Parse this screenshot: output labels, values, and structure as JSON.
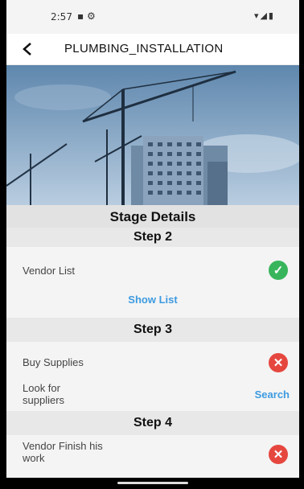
{
  "status_bar": {
    "time": "2:57"
  },
  "app_bar": {
    "title": "PLUMBING_INSTALLATION"
  },
  "stage": {
    "title": "Stage Details",
    "steps": [
      {
        "title": "Step 2",
        "item": "Vendor List",
        "status": "done",
        "action": "Show List"
      },
      {
        "title": "Step 3",
        "item": "Buy Supplies",
        "status": "not-done",
        "sub_item": "Look for\nsuppliers",
        "action": "Search"
      },
      {
        "title": "Step 4",
        "item": "Vendor Finish his\nwork",
        "status": "not-done"
      }
    ]
  },
  "colors": {
    "ok": "#38b55c",
    "bad": "#e5473f",
    "link": "#3d9be0"
  }
}
